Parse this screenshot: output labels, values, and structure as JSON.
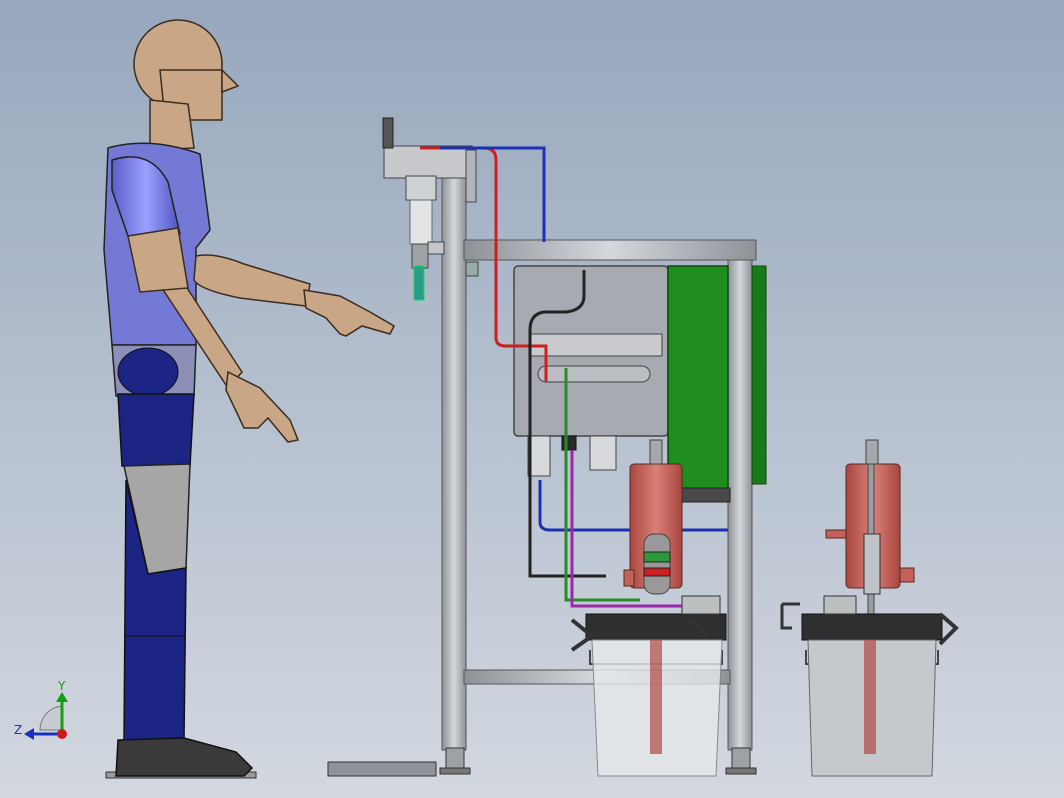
{
  "viewport": {
    "background_top": "#97a7bd",
    "background_bottom": "#d3d8e0"
  },
  "triad": {
    "y_label": "Y",
    "z_label": "Z",
    "y_color": "#12a012",
    "z_color": "#1c2fbf",
    "x_color": "#d01a1a"
  },
  "colors": {
    "shirt": "#7479d6",
    "pants": "#1c2584",
    "skin": "#c9a786",
    "frame": "#b9bdc2",
    "green_panel": "#1f8e1f",
    "red_pipe": "#cc1f1f",
    "blue_pipe": "#1d2fb2",
    "tank": "#c4615a",
    "bucket": "#c6c9cc"
  }
}
